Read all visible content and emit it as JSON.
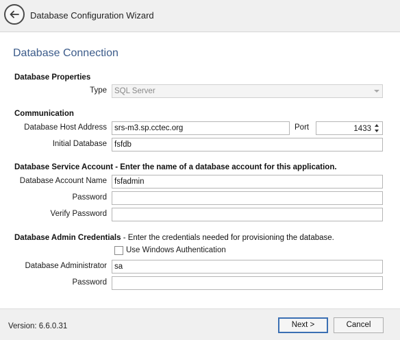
{
  "header": {
    "title": "Database Configuration Wizard",
    "back_icon": "back-arrow-icon"
  },
  "section_title": "Database Connection",
  "database_properties": {
    "heading": "Database Properties",
    "type_label": "Type",
    "type_value": "SQL Server"
  },
  "communication": {
    "heading": "Communication",
    "host_label": "Database Host Address",
    "host_value": "srs-m3.sp.cctec.org",
    "port_label": "Port",
    "port_value": "1433",
    "initial_db_label": "Initial Database",
    "initial_db_value": "fsfdb"
  },
  "service_account": {
    "heading": "Database Service Account - Enter the name of a database account for this application.",
    "account_name_label": "Database Account Name",
    "account_name_value": "fsfadmin",
    "password_label": "Password",
    "password_value": "",
    "verify_password_label": "Verify Password",
    "verify_password_value": ""
  },
  "admin_credentials": {
    "heading": "Database Admin Credentials",
    "heading_note": " - Enter the credentials needed for provisioning the database.",
    "windows_auth_label": "Use Windows Authentication",
    "windows_auth_checked": false,
    "admin_label": "Database Administrator",
    "admin_value": "sa",
    "password_label": "Password",
    "password_value": ""
  },
  "footer": {
    "version": "Version: 6.6.0.31",
    "next_label": "Next >",
    "cancel_label": "Cancel"
  }
}
